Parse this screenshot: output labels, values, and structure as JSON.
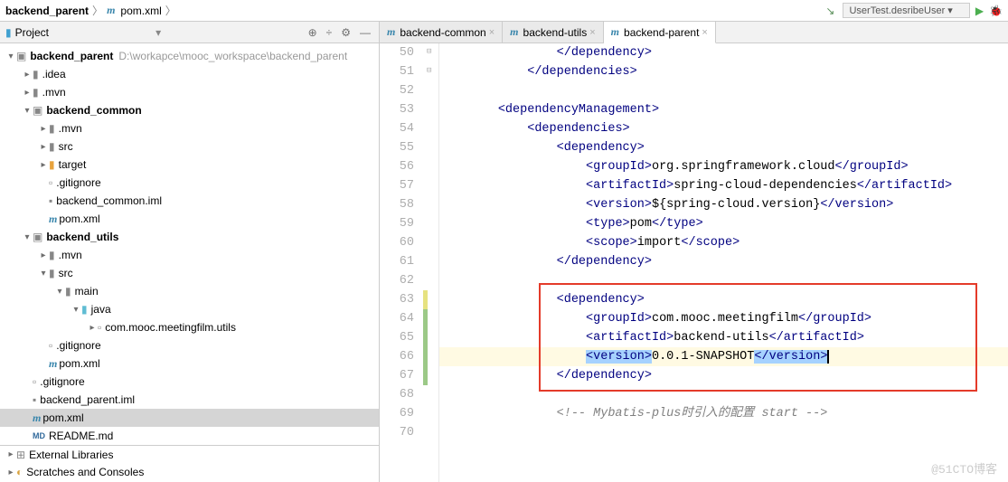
{
  "breadcrumb": {
    "root": "backend_parent",
    "file": "pom.xml"
  },
  "run": {
    "config": "UserTest.desribeUser"
  },
  "project": {
    "title": "Project"
  },
  "tree": {
    "root": {
      "name": "backend_parent",
      "path": "D:\\workapce\\mooc_workspace\\backend_parent"
    },
    "idea": ".idea",
    "mvn1": ".mvn",
    "common": "backend_common",
    "common_mvn": ".mvn",
    "common_src": "src",
    "common_target": "target",
    "common_git": ".gitignore",
    "common_iml": "backend_common.iml",
    "common_pom": "pom.xml",
    "utils": "backend_utils",
    "utils_mvn": ".mvn",
    "utils_src": "src",
    "utils_main": "main",
    "utils_java": "java",
    "utils_pkg": "com.mooc.meetingfilm.utils",
    "utils_git": ".gitignore",
    "utils_pom": "pom.xml",
    "git": ".gitignore",
    "iml": "backend_parent.iml",
    "pom": "pom.xml",
    "readme": "README.md",
    "ext": "External Libraries",
    "scratch": "Scratches and Consoles"
  },
  "tabs": {
    "t1": "backend-common",
    "t2": "backend-utils",
    "t3": "backend-parent"
  },
  "code": {
    "l50_a": "</",
    "l50_b": "dependency",
    "l50_c": ">",
    "l51_a": "</",
    "l51_b": "dependencies",
    "l51_c": ">",
    "l53_a": "<",
    "l53_b": "dependencyManagement",
    "l53_c": ">",
    "l54_a": "<",
    "l54_b": "dependencies",
    "l54_c": ">",
    "l55_a": "<",
    "l55_b": "dependency",
    "l55_c": ">",
    "l56_a": "<",
    "l56_b": "groupId",
    "l56_c": ">",
    "l56_d": "org.springframework.cloud",
    "l56_e": "</",
    "l56_f": "groupId",
    "l56_g": ">",
    "l57_a": "<",
    "l57_b": "artifactId",
    "l57_c": ">",
    "l57_d": "spring-cloud-dependencies",
    "l57_e": "</",
    "l57_f": "artifactId",
    "l57_g": ">",
    "l58_a": "<",
    "l58_b": "version",
    "l58_c": ">",
    "l58_d": "${spring-cloud.version}",
    "l58_e": "</",
    "l58_f": "version",
    "l58_g": ">",
    "l59_a": "<",
    "l59_b": "type",
    "l59_c": ">",
    "l59_d": "pom",
    "l59_e": "</",
    "l59_f": "type",
    "l59_g": ">",
    "l60_a": "<",
    "l60_b": "scope",
    "l60_c": ">",
    "l60_d": "import",
    "l60_e": "</",
    "l60_f": "scope",
    "l60_g": ">",
    "l61_a": "</",
    "l61_b": "dependency",
    "l61_c": ">",
    "l63_a": "<",
    "l63_b": "dependency",
    "l63_c": ">",
    "l64_a": "<",
    "l64_b": "groupId",
    "l64_c": ">",
    "l64_d": "com.mooc.meetingfilm",
    "l64_e": "</",
    "l64_f": "groupId",
    "l64_g": ">",
    "l65_a": "<",
    "l65_b": "artifactId",
    "l65_c": ">",
    "l65_d": "backend-utils",
    "l65_e": "</",
    "l65_f": "artifactId",
    "l65_g": ">",
    "l66_a": "<",
    "l66_b": "version",
    "l66_c": ">",
    "l66_d": "0.0.1-SNAPSHOT",
    "l66_e": "</",
    "l66_f": "version",
    "l66_g": ">",
    "l67_a": "</",
    "l67_b": "dependency",
    "l67_c": ">",
    "l69": "<!-- Mybatis-plus时引入的配置 start -->"
  },
  "gutter": {
    "start": 50,
    "end": 70
  },
  "watermark": "@51CTO博客"
}
